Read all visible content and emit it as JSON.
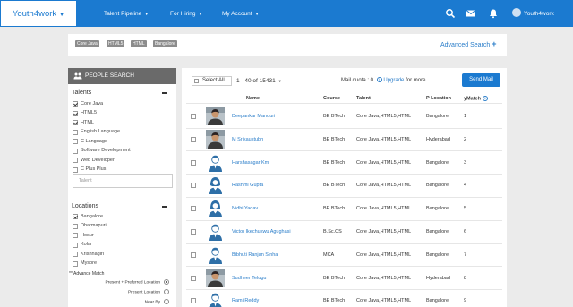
{
  "nav": {
    "brand": "Youth4work",
    "menus": [
      "Talent Pipeline",
      "For Hiring",
      "My Account"
    ],
    "user": "Youth4work"
  },
  "filters": {
    "tags": [
      "Core Java",
      "HTML5",
      "HTML",
      "Bangalore"
    ],
    "advanced_search": "Advanced Search"
  },
  "sidebar": {
    "title": "PEOPLE SEARCH",
    "talents_label": "Talents",
    "talents": [
      {
        "label": "Core Java",
        "checked": true
      },
      {
        "label": "HTML5",
        "checked": true
      },
      {
        "label": "HTML",
        "checked": true
      },
      {
        "label": "English Language",
        "checked": false
      },
      {
        "label": "C Language",
        "checked": false
      },
      {
        "label": "Software Development",
        "checked": false
      },
      {
        "label": "Web Developer",
        "checked": false
      },
      {
        "label": "C Plus Plus",
        "checked": false
      }
    ],
    "talent_placeholder": "Talent",
    "locations_label": "Locations",
    "locations": [
      {
        "label": "Bangalore",
        "checked": true
      },
      {
        "label": "Dharmapuri",
        "checked": false
      },
      {
        "label": "Hosur",
        "checked": false
      },
      {
        "label": "Kolar",
        "checked": false
      },
      {
        "label": "Krishnagiri",
        "checked": false
      },
      {
        "label": "Mysore",
        "checked": false
      }
    ],
    "advance_match": "** Advance Match",
    "match_options": [
      {
        "label": "Present + Preferred Location",
        "selected": true
      },
      {
        "label": "Present Location",
        "selected": false
      },
      {
        "label": "Near By",
        "selected": false
      }
    ]
  },
  "results": {
    "select_all": "Select All",
    "range": "1 - 40 of 15431",
    "mail_quota_label": "Mail quota : 0",
    "upgrade": "Upgrade",
    "for_more": "for more",
    "send_mail": "Send Mail",
    "columns": [
      "Name",
      "Course",
      "Talent",
      "P Location",
      "yMatch"
    ],
    "rows": [
      {
        "name": "Deepankar Manduri",
        "course": "BE BTech",
        "talent": "Core Java,HTML5,HTML",
        "location": "Bangalore",
        "ymatch": "1",
        "photo": "photo"
      },
      {
        "name": "M Srikaustubh",
        "course": "BE BTech",
        "talent": "Core Java,HTML5,HTML",
        "location": "Hyderabad",
        "ymatch": "2",
        "photo": "photo"
      },
      {
        "name": "Harshasagar Km",
        "course": "BE BTech",
        "talent": "Core Java,HTML5,HTML",
        "location": "Bangalore",
        "ymatch": "3",
        "photo": "male"
      },
      {
        "name": "Rashmi Gupta",
        "course": "BE BTech",
        "talent": "Core Java,HTML5,HTML",
        "location": "Bangalore",
        "ymatch": "4",
        "photo": "female"
      },
      {
        "name": "Nidhi Yadav",
        "course": "BE BTech",
        "talent": "Core Java,HTML5,HTML",
        "location": "Bangalore",
        "ymatch": "5",
        "photo": "female"
      },
      {
        "name": "Victor Ikechukwu Agughasi",
        "course": "B.Sc.CS",
        "talent": "Core Java,HTML5,HTML",
        "location": "Bangalore",
        "ymatch": "6",
        "photo": "male"
      },
      {
        "name": "Bibhuti Ranjan Sinha",
        "course": "MCA",
        "talent": "Core Java,HTML5,HTML",
        "location": "Bangalore",
        "ymatch": "7",
        "photo": "male"
      },
      {
        "name": "Sudheer Telugu",
        "course": "BE BTech",
        "talent": "Core Java,HTML5,HTML",
        "location": "Hyderabad",
        "ymatch": "8",
        "photo": "photo"
      },
      {
        "name": "Rami Reddy",
        "course": "BE BTech",
        "talent": "Core Java,HTML5,HTML",
        "location": "Bangalore",
        "ymatch": "9",
        "photo": "male"
      }
    ]
  },
  "colors": {
    "primary": "#1b7ad0",
    "link": "#2a7dc9",
    "tag": "#8c8c8c",
    "sidebar_header": "#6a6a6a"
  }
}
